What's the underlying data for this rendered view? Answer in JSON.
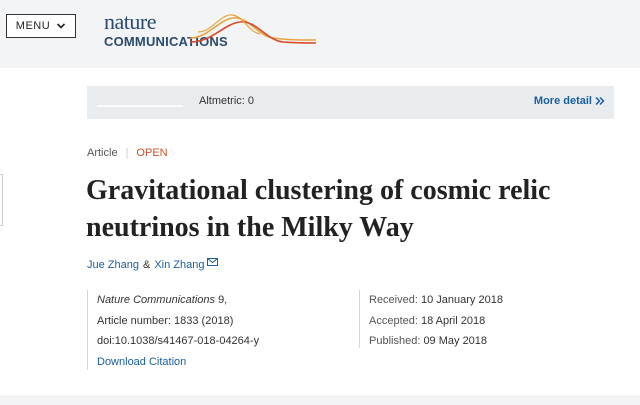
{
  "header": {
    "menu_label": "MENU",
    "logo_line1": "nature",
    "logo_line2": "COMMUNICATIONS",
    "logo_colors": [
      "#e8a33b",
      "#d9482b",
      "#2a4a6e"
    ]
  },
  "altmetric": {
    "text": "Altmetric: 0",
    "more_label": "More detail"
  },
  "article": {
    "type": "Article",
    "access": "OPEN",
    "title": "Gravitational clustering of cosmic relic neutrinos in the Milky Way",
    "author1": "Jue Zhang",
    "amp": "&",
    "author2": "Xin Zhang",
    "journal": "Nature Communications",
    "volume": "9,",
    "article_number": "Article number: 1833 (2018)",
    "doi": "doi:10.1038/s41467-018-04264-y",
    "download_citation": "Download Citation",
    "received_label": "Received:",
    "received_date": "10 January 2018",
    "accepted_label": "Accepted:",
    "accepted_date": "18 April 2018",
    "published_label": "Published:",
    "published_date": "09 May 2018"
  },
  "icons": {
    "menu_chevron": "chevron-down-icon",
    "more_chevron": "double-chevron-right-icon",
    "email": "envelope-icon"
  }
}
